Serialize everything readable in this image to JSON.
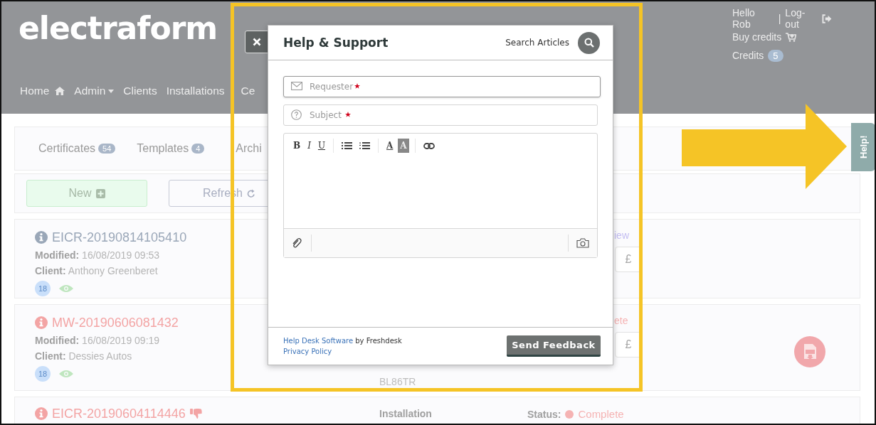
{
  "header": {
    "logo": "electraform",
    "nav": [
      {
        "label": "Home",
        "kind": "home"
      },
      {
        "label": "Admin",
        "kind": "dropdown"
      },
      {
        "label": "Clients",
        "kind": "plain"
      },
      {
        "label": "Installations",
        "kind": "plain"
      },
      {
        "label": "Ce",
        "kind": "plain"
      }
    ],
    "user": {
      "greeting": "Hello Rob",
      "separator": "|",
      "logout": "Log-out",
      "buy_credits": "Buy credits",
      "credits_label": "Credits",
      "credits_count": "5"
    }
  },
  "tabs": [
    {
      "label": "Certificates",
      "count": "54"
    },
    {
      "label": "Templates",
      "count": "4"
    },
    {
      "label": "Archi"
    }
  ],
  "actions": [
    {
      "kind": "new",
      "label": "New"
    },
    {
      "kind": "refresh",
      "label": "Refresh"
    }
  ],
  "certificates": [
    {
      "kind": "summary",
      "title": "EICR-20190814105410",
      "color": "#9aa7b8",
      "modified_label": "Modified:",
      "modified": "16/08/2019 09:53",
      "client_label": "Client:",
      "client": "Anthony Greenberet",
      "count": "18",
      "status": {
        "text": "iew",
        "color": "#c3bdf2"
      },
      "price": "£"
    },
    {
      "kind": "summary",
      "title": "MW-20190606081432",
      "color": "#f3a4a4",
      "modified_label": "Modified:",
      "modified": "16/08/2019 09:19",
      "client_label": "Client:",
      "client": "Dessies Autos",
      "count": "18",
      "address": "BL86TR",
      "status": {
        "text": "ete",
        "color": "#f5b3b3"
      },
      "price": "£",
      "pdf": true
    },
    {
      "kind": "compact",
      "title": "EICR-20190604114446",
      "color": "#f3a4a4",
      "thumbs_down": true,
      "installation_label": "Installation",
      "status_label": "Status:",
      "status": {
        "text": "Complete",
        "color": "#f5b3b3"
      }
    }
  ],
  "help_tab": {
    "label": "Help!"
  },
  "modal": {
    "title": "Help & Support",
    "search_label": "Search Articles",
    "fields": [
      {
        "kind": "email",
        "placeholder": "Requester",
        "required": true,
        "focused": true
      },
      {
        "kind": "subject",
        "placeholder": "Subject",
        "required": true,
        "focused": false
      }
    ],
    "editor_tools": [
      {
        "kind": "bold",
        "label": "B"
      },
      {
        "kind": "italic",
        "label": "I"
      },
      {
        "kind": "underline",
        "label": "U"
      },
      {
        "kind": "divider"
      },
      {
        "kind": "bullets"
      },
      {
        "kind": "numbers"
      },
      {
        "kind": "divider"
      },
      {
        "kind": "color",
        "label": "A"
      },
      {
        "kind": "highlight",
        "label": "A"
      },
      {
        "kind": "divider"
      },
      {
        "kind": "link"
      }
    ],
    "footer": {
      "link": "Help Desk Software",
      "suffix": " by Freshdesk",
      "privacy": "Privacy Policy",
      "submit": "Send Feedback"
    }
  }
}
